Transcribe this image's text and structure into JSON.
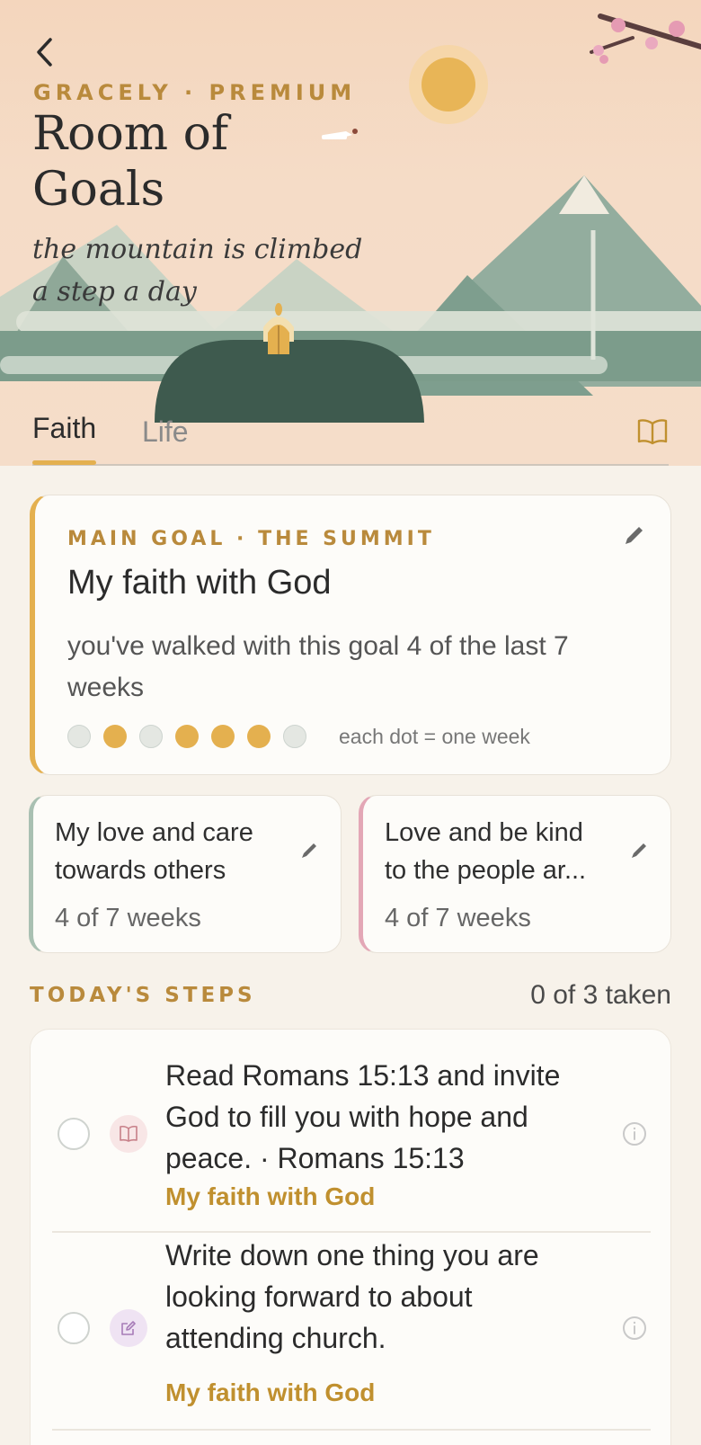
{
  "header": {
    "eyebrow": "GRACELY · PREMIUM",
    "title": "Room of Goals",
    "tagline": "the mountain is climbed a step a day",
    "back_icon": "chevron-left-icon"
  },
  "tabs": [
    {
      "label": "Faith",
      "active": true
    },
    {
      "label": "Life",
      "active": false
    }
  ],
  "colors": {
    "accent": "#e4b04f",
    "accent_text": "#b98a3c",
    "sage": "#8fad9b",
    "rose": "#e3a7b6",
    "dark_green": "#3e5a4e"
  },
  "main_goal": {
    "label": "MAIN GOAL · THE SUMMIT",
    "title": "My faith with God",
    "streak_text": "you've walked with this goal 4 of the last 7 weeks",
    "weeks": [
      false,
      true,
      false,
      true,
      true,
      true,
      false
    ],
    "legend": "each dot = one week"
  },
  "sub_goals": [
    {
      "title": "My love and care towards others",
      "count": "4 of 7 weeks",
      "color": "#a9c0b2"
    },
    {
      "title": "Love and be kind to the people ar...",
      "count": "4 of 7 weeks",
      "color": "#e3a7b6"
    }
  ],
  "steps": {
    "heading": "TODAY'S STEPS",
    "count": "0 of 3 taken",
    "items": [
      {
        "text": "Read Romans 15:13 and invite God to fill you with hope and peace. · Romans 15:13",
        "goal": "My faith with God",
        "icon": "book-icon",
        "done": false
      },
      {
        "text": "Write down one thing you are looking forward to about attending church.",
        "goal": "My faith with God",
        "icon": "journal-edit-icon",
        "done": false
      }
    ]
  }
}
